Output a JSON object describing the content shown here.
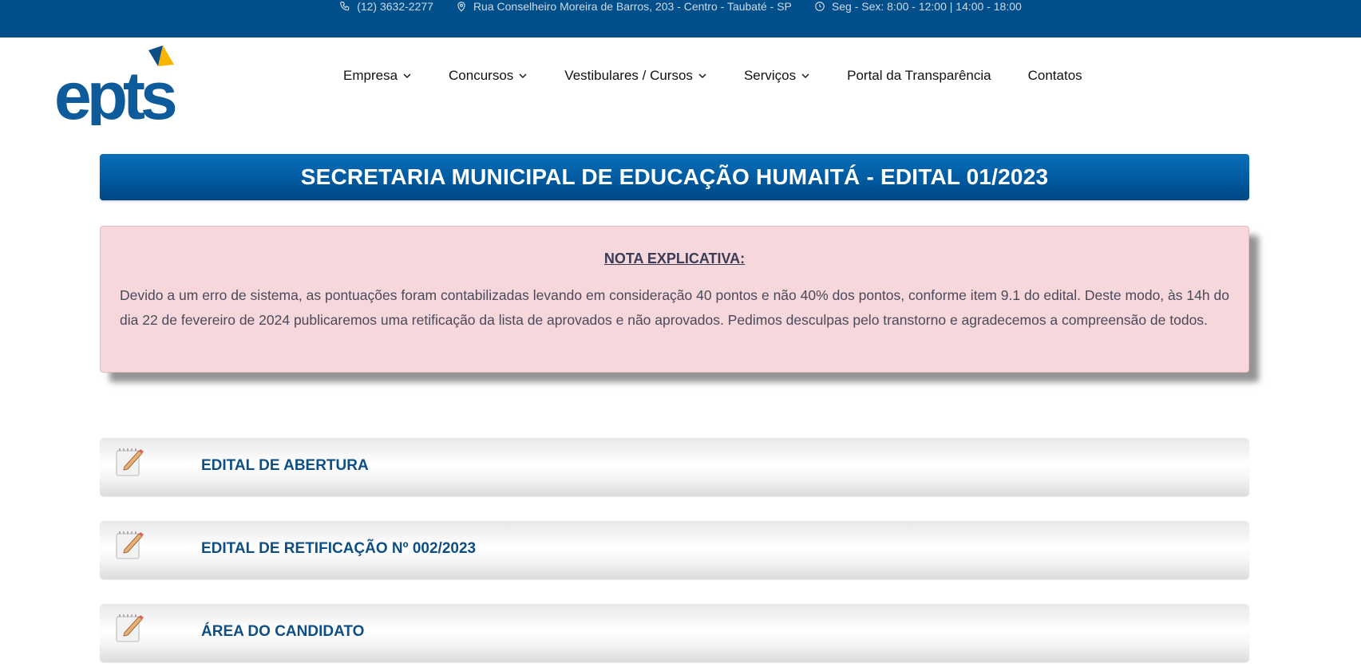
{
  "topbar": {
    "phone": "(12) 3632-2277",
    "address": "Rua Conselheiro Moreira de Barros, 203 - Centro - Taubaté - SP",
    "hours": "Seg - Sex: 8:00 - 12:00 | 14:00 - 18:00"
  },
  "logo": {
    "text": "epts"
  },
  "nav": {
    "items": [
      {
        "label": "Empresa",
        "has_dropdown": true
      },
      {
        "label": "Concursos",
        "has_dropdown": true
      },
      {
        "label": "Vestibulares / Cursos",
        "has_dropdown": true
      },
      {
        "label": "Serviços",
        "has_dropdown": true
      },
      {
        "label": "Portal da Transparência",
        "has_dropdown": false
      },
      {
        "label": "Contatos",
        "has_dropdown": false
      }
    ]
  },
  "title": "SECRETARIA MUNICIPAL DE EDUCAÇÃO HUMAITÁ - EDITAL 01/2023",
  "note": {
    "heading": "NOTA EXPLICATIVA:",
    "body": "Devido a um erro de sistema, as pontuações foram contabilizadas levando em consideração 40 pontos e não 40% dos pontos, conforme item 9.1 do edital. Deste modo, às 14h do dia 22 de fevereiro de 2024 publicaremos uma retificação da lista de aprovados e não aprovados. Pedimos desculpas pelo transtorno e agradecemos a compreensão de todos."
  },
  "sections": [
    {
      "label": "EDITAL DE ABERTURA"
    },
    {
      "label": "EDITAL DE RETIFICAÇÃO Nº 002/2023"
    },
    {
      "label": "ÁREA DO CANDIDATO"
    }
  ],
  "colors": {
    "topbar_bg": "#004f8b",
    "brand_blue": "#005aa0",
    "note_bg": "#f6d7db",
    "section_text": "#0d4f85",
    "logo_accent": "#f7b500"
  }
}
